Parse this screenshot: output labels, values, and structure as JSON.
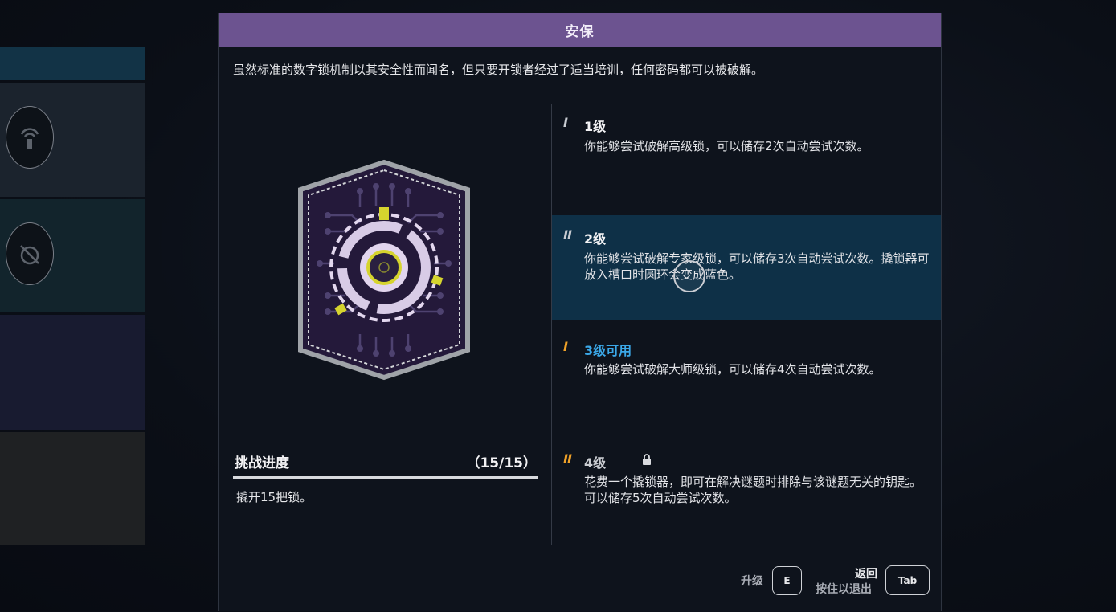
{
  "panel": {
    "title": "安保",
    "description": "虽然标准的数字锁机制以其安全性而闻名，但只要开锁者经过了适当培训，任何密码都可以被破解。"
  },
  "challenge": {
    "title": "挑战进度",
    "count": "（15/15）",
    "progress": 1.0,
    "description": "撬开15把锁。"
  },
  "tiers": [
    {
      "mark": "I",
      "title": "1级",
      "description": "你能够尝试破解高级锁，可以储存2次自动尝试次数。",
      "mark_color": "#c8ccd2",
      "title_color": "#f2f2f4",
      "selected": false,
      "locked": false
    },
    {
      "mark": "II",
      "title": "2级",
      "description": "你能够尝试破解专家级锁，可以储存3次自动尝试次数。撬锁器可放入槽口时圆环会变成蓝色。",
      "mark_color": "#c8ccd2",
      "title_color": "#f2f2f4",
      "selected": true,
      "locked": false
    },
    {
      "mark": "I",
      "title": "3级可用",
      "description": "你能够尝试破解大师级锁，可以储存4次自动尝试次数。",
      "mark_color": "#f0a228",
      "title_color": "#3ba8e8",
      "selected": false,
      "locked": false
    },
    {
      "mark": "II",
      "title": "4级",
      "description": "花费一个撬锁器，即可在解决谜题时排除与该谜题无关的钥匙。可以储存5次自动尝试次数。",
      "mark_color": "#f0a228",
      "title_color": "#c9ccd1",
      "selected": false,
      "locked": true
    }
  ],
  "footer": {
    "upgrade_label": "升级",
    "upgrade_key": "E",
    "back_label": "返回",
    "back_hint": "按住以退出",
    "back_key": "Tab"
  },
  "icons": [
    "antenna-badge-icon",
    "lockpick-badge-icon",
    "circuit-badge-icon",
    "lock-icon"
  ],
  "colors": {
    "header": "#6c5390",
    "selected_tier": "#0e3047",
    "available_mark": "#f0a228",
    "available_title": "#3ba8e8"
  }
}
